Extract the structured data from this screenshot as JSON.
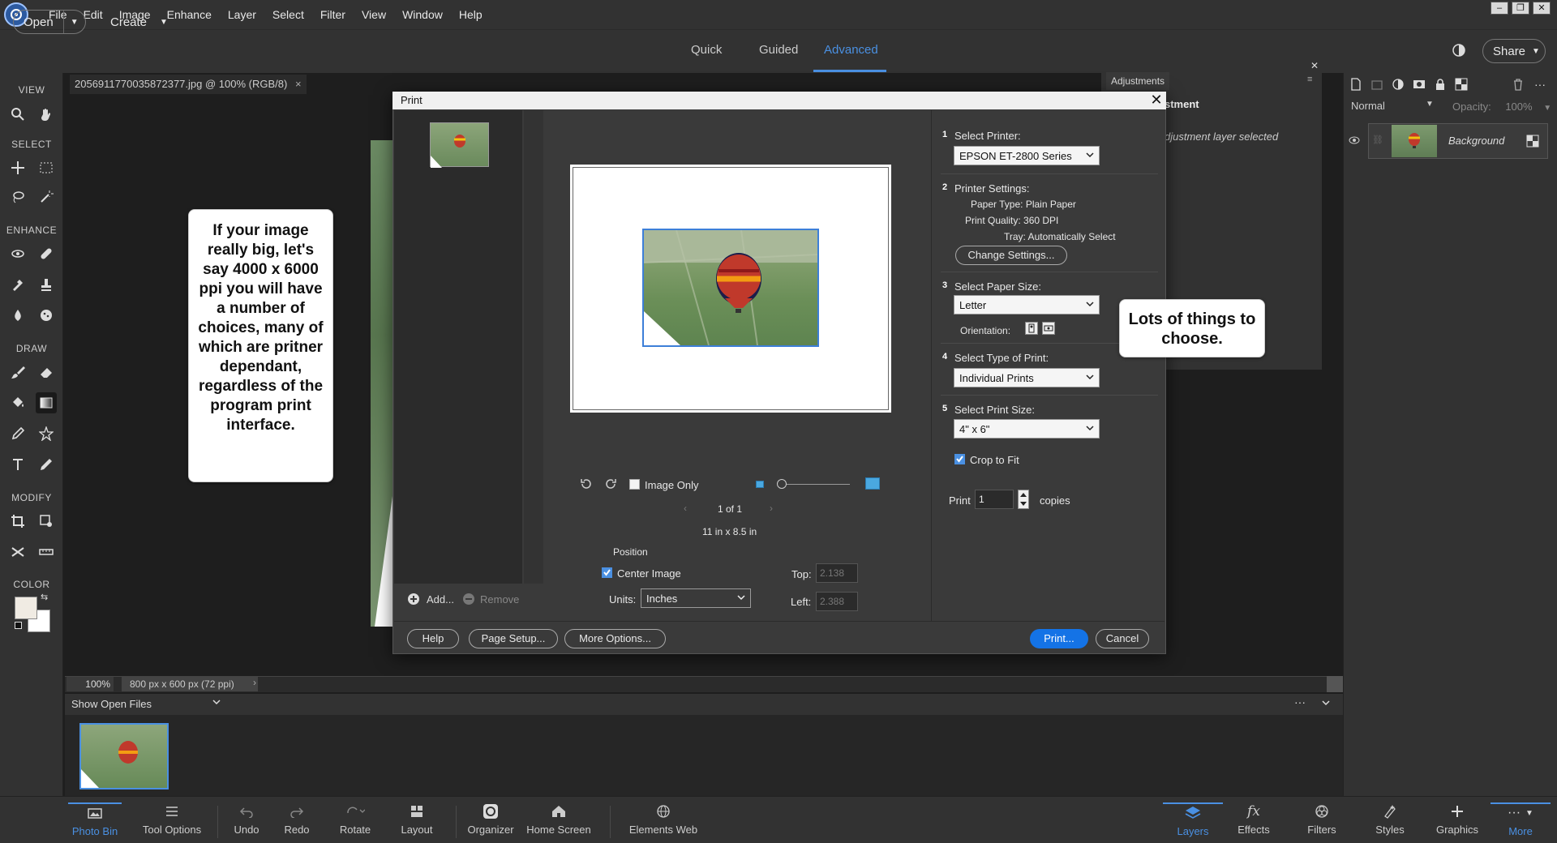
{
  "menubar": {
    "items": [
      "File",
      "Edit",
      "Image",
      "Enhance",
      "Layer",
      "Select",
      "Filter",
      "View",
      "Window",
      "Help"
    ]
  },
  "topbar": {
    "open_label": "Open",
    "create_label": "Create",
    "modes": [
      "Quick",
      "Guided",
      "Advanced"
    ],
    "active_mode": "Advanced",
    "share_label": "Share"
  },
  "toolbox": {
    "sections": {
      "view": "VIEW",
      "select": "SELECT",
      "enhance": "ENHANCE",
      "draw": "DRAW",
      "modify": "MODIFY",
      "color": "COLOR"
    }
  },
  "document": {
    "tab_title": "2056911770035872377.jpg @ 100% (RGB/8)",
    "tab_close": "×"
  },
  "callouts": {
    "left": "If your image really big, let's say 4000 x 6000 ppi you will have a number of choices, many of which are pritner dependant, regardless of the program print interface.",
    "right": "Lots of things to choose."
  },
  "adjustments": {
    "tab": "Adjustments",
    "title": "stment",
    "message": "djustment layer selected"
  },
  "layers": {
    "blend_mode": "Normal",
    "opacity_label": "Opacity:",
    "opacity_value": "100%",
    "layer_name": "Background"
  },
  "print_dialog": {
    "title": "Print",
    "add_label": "Add...",
    "remove_label": "Remove",
    "image_only_label": "Image Only",
    "page_indicator": "1 of 1",
    "paper_dims": "11 in x 8.5 in",
    "position_label": "Position",
    "center_image_label": "Center Image",
    "units_label": "Units:",
    "units_value": "Inches",
    "top_label": "Top:",
    "top_value": "2.138",
    "left_label": "Left:",
    "left_value": "2.388",
    "steps": {
      "s1": {
        "n": "1",
        "label": "Select Printer:",
        "value": "EPSON ET-2800 Series"
      },
      "s2": {
        "n": "2",
        "label": "Printer Settings:",
        "paper_type": "Paper Type:  Plain Paper",
        "print_quality": "Print Quality:  360 DPI",
        "tray": "Tray:  Automatically Select",
        "change_btn": "Change Settings..."
      },
      "s3": {
        "n": "3",
        "label": "Select Paper Size:",
        "value": "Letter",
        "orientation_label": "Orientation:"
      },
      "s4": {
        "n": "4",
        "label": "Select Type of Print:",
        "value": "Individual Prints"
      },
      "s5": {
        "n": "5",
        "label": "Select Print Size:",
        "value": "4\" x 6\"",
        "crop_label": "Crop to Fit"
      }
    },
    "print_label": "Print",
    "copies_value": "1",
    "copies_label": "copies",
    "buttons": {
      "help": "Help",
      "page_setup": "Page Setup...",
      "more_options": "More Options...",
      "print": "Print...",
      "cancel": "Cancel"
    }
  },
  "status": {
    "zoom": "100%",
    "doc_info": "800 px x 600 px (72 ppi)"
  },
  "photobin": {
    "label": "Show Open Files"
  },
  "taskbar": {
    "left": [
      "Photo Bin",
      "Tool Options",
      "Undo",
      "Redo",
      "Rotate",
      "Layout",
      "Organizer",
      "Home Screen",
      "Elements Web"
    ],
    "right": [
      "Layers",
      "Effects",
      "Filters",
      "Styles",
      "Graphics",
      "More"
    ]
  },
  "colors": {
    "accent": "#4a90e2",
    "print_button": "#1473e6",
    "panel": "#323232",
    "workspace": "#1e1e1e"
  }
}
